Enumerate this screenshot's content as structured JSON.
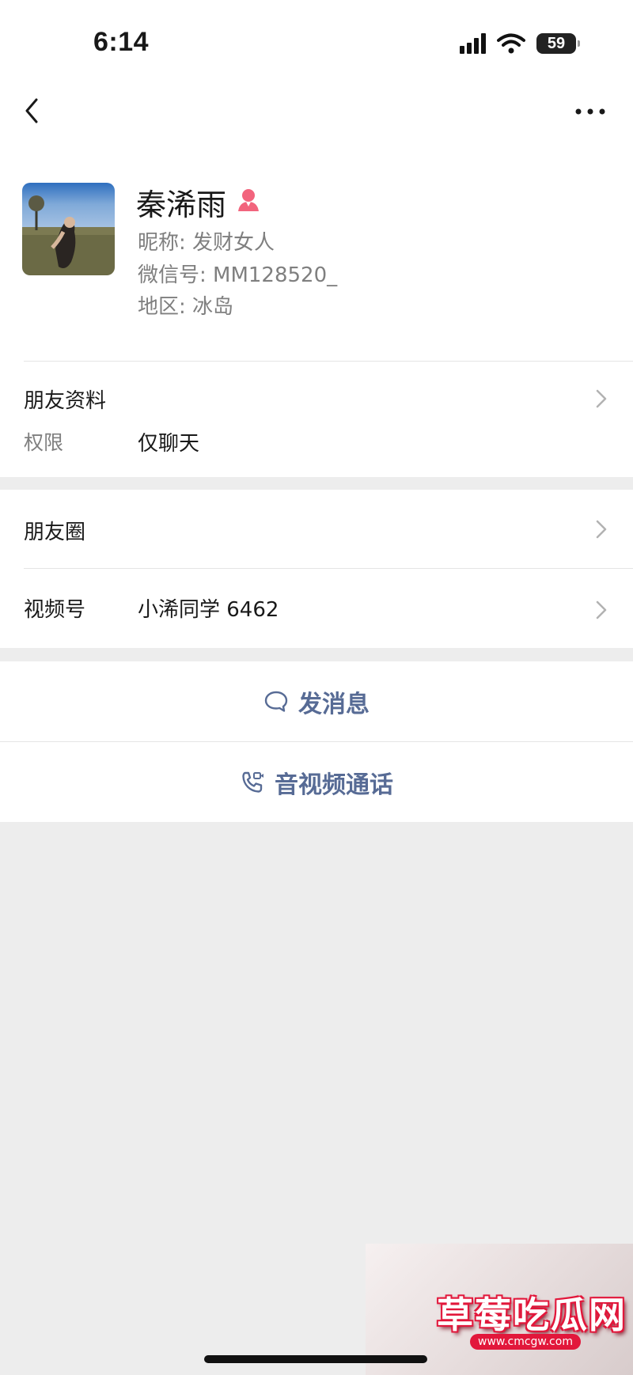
{
  "status_bar": {
    "time": "6:14",
    "battery": "59"
  },
  "profile": {
    "name": "秦浠雨",
    "nickname": "昵称: 发财女人",
    "wechat_id": "微信号: MM128520_",
    "region": "地区: 冰岛"
  },
  "friend_info": {
    "label": "朋友资料",
    "permission_label": "权限",
    "permission_value": "仅聊天"
  },
  "moments": {
    "label": "朋友圈"
  },
  "channels": {
    "label": "视频号",
    "value": "小浠同学 6462"
  },
  "actions": {
    "message": "发消息",
    "call": "音视频通话"
  },
  "watermark": {
    "text": "草莓吃瓜网",
    "url": "www.cmcgw.com"
  },
  "colors": {
    "accent": "#576b95",
    "background": "#ededed",
    "gender": "#f2647d"
  }
}
